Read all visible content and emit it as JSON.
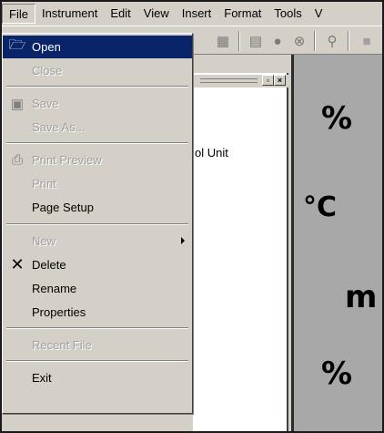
{
  "menubar": {
    "items": [
      "File",
      "Instrument",
      "Edit",
      "View",
      "Insert",
      "Format",
      "Tools",
      "V"
    ]
  },
  "file_menu": {
    "items": [
      {
        "label": "Open",
        "enabled": true,
        "selected": true,
        "icon": "open-folder-icon"
      },
      {
        "label": "Close",
        "enabled": false
      },
      {
        "label": "Save",
        "enabled": false,
        "icon": "save-disk-icon"
      },
      {
        "label": "Save As...",
        "enabled": false
      },
      {
        "label": "Print Preview",
        "enabled": false,
        "icon": "print-preview-icon"
      },
      {
        "label": "Print",
        "enabled": false
      },
      {
        "label": "Page Setup",
        "enabled": true
      },
      {
        "label": "New",
        "enabled": false,
        "submenu": true
      },
      {
        "label": "Delete",
        "enabled": true,
        "icon": "delete-x-icon"
      },
      {
        "label": "Rename",
        "enabled": true
      },
      {
        "label": "Properties",
        "enabled": true
      },
      {
        "label": "Recent File",
        "enabled": false
      },
      {
        "label": "Exit",
        "enabled": true
      }
    ]
  },
  "document": {
    "visible_text": "ol Unit"
  },
  "panel": {
    "units": [
      "%",
      "°C",
      "m",
      "%"
    ]
  },
  "colors": {
    "menu_bg": "#d4d0c8",
    "selection": "#0a246a",
    "panel_bg": "#a8a8a8"
  }
}
